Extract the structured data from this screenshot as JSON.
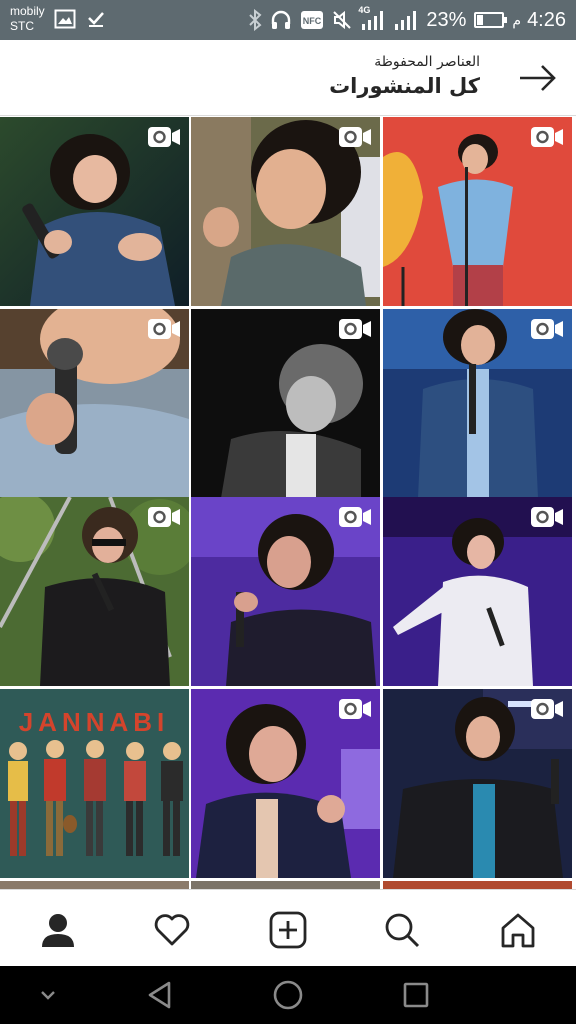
{
  "status_bar": {
    "carrier_line1": "mobily",
    "carrier_line2": "STC",
    "network_type": "4G",
    "battery_percent_label": "23%",
    "battery_level": 0.23,
    "ampm": "م",
    "time": "4:26",
    "icons": [
      "image-icon",
      "check-icon",
      "bluetooth-icon",
      "headphones-icon",
      "nfc-icon",
      "mute-icon",
      "signal-icon",
      "signal-icon",
      "battery-icon"
    ]
  },
  "header": {
    "subtitle": "العناصر المحفوظة",
    "title": "كل المنشورات",
    "back_icon": "arrow-right-icon"
  },
  "grid": {
    "tiles": [
      {
        "id": 1,
        "type": "video",
        "bg": "#1f3a2c"
      },
      {
        "id": 2,
        "type": "video",
        "bg": "#4a4a3c"
      },
      {
        "id": 3,
        "type": "video",
        "bg": "#d94a3a"
      },
      {
        "id": 4,
        "type": "video",
        "bg": "#6e7b8a"
      },
      {
        "id": 5,
        "type": "video",
        "bg": "#111111"
      },
      {
        "id": 6,
        "type": "video",
        "bg": "#1f3f7a"
      },
      {
        "id": 7,
        "type": "video",
        "bg": "#4e6b36"
      },
      {
        "id": 8,
        "type": "video",
        "bg": "#4b2a9e"
      },
      {
        "id": 9,
        "type": "video",
        "bg": "#3a1f8a"
      },
      {
        "id": 10,
        "type": "image",
        "bg": "#2d5a58",
        "poster_text": "JANNABI"
      },
      {
        "id": 11,
        "type": "video",
        "bg": "#5b2bb0"
      },
      {
        "id": 12,
        "type": "video",
        "bg": "#1b2240"
      }
    ]
  },
  "bottom_nav": {
    "items": [
      "profile-icon",
      "heart-icon",
      "add-post-icon",
      "search-icon",
      "home-icon"
    ]
  },
  "system_nav": {
    "items": [
      "chevron-down-icon",
      "back-triangle-icon",
      "home-circle-icon",
      "recents-square-icon"
    ]
  },
  "colors": {
    "status_bar": "#5e6a70",
    "divider": "#dbdbdb",
    "text": "#262626"
  }
}
